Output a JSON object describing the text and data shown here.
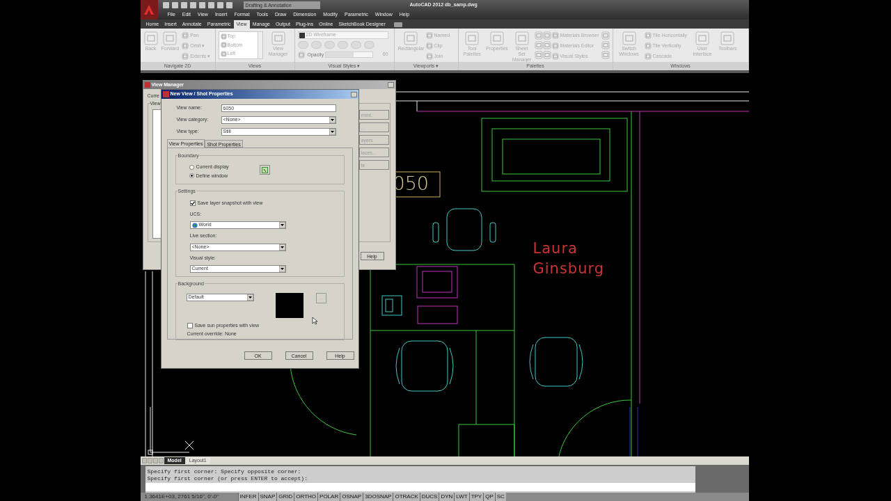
{
  "title_bar": {
    "workspace": "Drafting & Annotation",
    "title": "AutoCAD 2012   db_samp.dwg"
  },
  "menu": [
    "File",
    "Edit",
    "View",
    "Insert",
    "Format",
    "Tools",
    "Draw",
    "Dimension",
    "Modify",
    "Parametric",
    "Window",
    "Help"
  ],
  "ribbon_tabs": [
    {
      "label": "Home",
      "selected": false
    },
    {
      "label": "Insert",
      "selected": false
    },
    {
      "label": "Annotate",
      "selected": false
    },
    {
      "label": "Parametric",
      "selected": false
    },
    {
      "label": "View",
      "selected": true
    },
    {
      "label": "Manage",
      "selected": false
    },
    {
      "label": "Output",
      "selected": false
    },
    {
      "label": "Plug-ins",
      "selected": false
    },
    {
      "label": "Online",
      "selected": false
    },
    {
      "label": "SketchBook Designer",
      "selected": false
    }
  ],
  "ribbon_panels": [
    {
      "title": "Navigate 2D",
      "items": [
        {
          "kind": "large",
          "label": "Back"
        },
        {
          "kind": "large",
          "label": "Forward"
        },
        {
          "kind": "small",
          "label": "Pan"
        },
        {
          "kind": "small",
          "label": "Orbit ▾"
        },
        {
          "kind": "small",
          "label": "Extents ▾"
        }
      ]
    },
    {
      "title": "Views",
      "items": [
        {
          "kind": "list",
          "entries": [
            "Top",
            "Bottom",
            "Left"
          ]
        },
        {
          "kind": "large",
          "label": "View Manager"
        }
      ]
    },
    {
      "title": "Visual Styles ▾",
      "items": [
        {
          "kind": "styles",
          "value": "2D Wireframe",
          "label": "Opacity",
          "level": 0.6,
          "reading": "60"
        }
      ]
    },
    {
      "title": "Viewports ▾",
      "items": [
        {
          "kind": "large",
          "label": "Rectangular"
        },
        {
          "kind": "small",
          "label": "Named"
        },
        {
          "kind": "small",
          "label": "Clip"
        },
        {
          "kind": "small",
          "label": "Join"
        }
      ]
    },
    {
      "title": "Palettes",
      "items": [
        {
          "kind": "large",
          "label": "Tool Palettes"
        },
        {
          "kind": "large",
          "label": "Properties"
        },
        {
          "kind": "large",
          "label": "Sheet Set Manager"
        },
        {
          "kind": "grid"
        },
        {
          "kind": "small",
          "label": "Materials Browser"
        },
        {
          "kind": "small",
          "label": "Materials Editor"
        },
        {
          "kind": "small",
          "label": "Visual Styles"
        },
        {
          "kind": "icons"
        }
      ]
    },
    {
      "title": "Windows",
      "items": [
        {
          "kind": "large",
          "label": "Switch Windows"
        },
        {
          "kind": "small",
          "label": "Tile Horizontally"
        },
        {
          "kind": "small",
          "label": "Tile Vertically"
        },
        {
          "kind": "small",
          "label": "Cascade"
        },
        {
          "kind": "large",
          "label": "User Interface"
        },
        {
          "kind": "large",
          "label": "Toolbars"
        }
      ]
    }
  ],
  "drawing": {
    "room_number": "050",
    "occupant": "Laura Ginsburg"
  },
  "view_manager": {
    "title": "View Manager",
    "current_label": "Curre",
    "group_label": "View",
    "buttons": [
      "rrent.",
      "...",
      "ayers",
      "laces...",
      "te"
    ],
    "help": "Help"
  },
  "new_view_dialog": {
    "title": "New View / Shot Properties",
    "fields": [
      {
        "label": "View name:",
        "kind": "text",
        "value": "6050"
      },
      {
        "label": "View category:",
        "kind": "select",
        "value": "<None>"
      },
      {
        "label": "View type:",
        "kind": "select",
        "value": "Still"
      }
    ],
    "tabs": [
      {
        "label": "View Properties",
        "selected": true
      },
      {
        "label": "Shot Properties",
        "selected": false
      }
    ],
    "boundary": {
      "title": "Boundary",
      "options": [
        {
          "label": "Current display",
          "selected": false
        },
        {
          "label": "Define window",
          "selected": true
        }
      ]
    },
    "settings": {
      "title": "Settings",
      "snapshot": {
        "label": "Save layer snapshot with view",
        "checked": true
      },
      "selects": [
        {
          "label": "UCS:",
          "value": "World",
          "kind": "globe"
        },
        {
          "label": "Live section:",
          "value": "<None>",
          "kind": "plain"
        },
        {
          "label": "Visual style:",
          "value": "Current",
          "kind": "plain"
        }
      ]
    },
    "background": {
      "title": "Background",
      "value": "Default",
      "color": "#000000",
      "browse": "...",
      "sun": {
        "label": "Save sun properties with view",
        "checked": false
      },
      "override": "Current override: None"
    },
    "buttons": [
      "OK",
      "Cancel",
      "Help"
    ]
  },
  "layout_tabs": [
    {
      "label": "Model",
      "selected": true
    },
    {
      "label": "Layout1",
      "selected": false
    }
  ],
  "command_lines": [
    "Specify first corner: Specify opposite corner:",
    "Specify first corner (or press ENTER to accept):"
  ],
  "status_bar": {
    "coordinates": "1.3641E+03, 2761 5/16\", 0'-0\"",
    "toggles": [
      "INFER",
      "SNAP",
      "GRID",
      "ORTHO",
      "POLAR",
      "OSNAP",
      "3DOSNAP",
      "OTRACK",
      "DUCS",
      "DYN",
      "LWT",
      "TPY",
      "QP",
      "SC"
    ]
  }
}
